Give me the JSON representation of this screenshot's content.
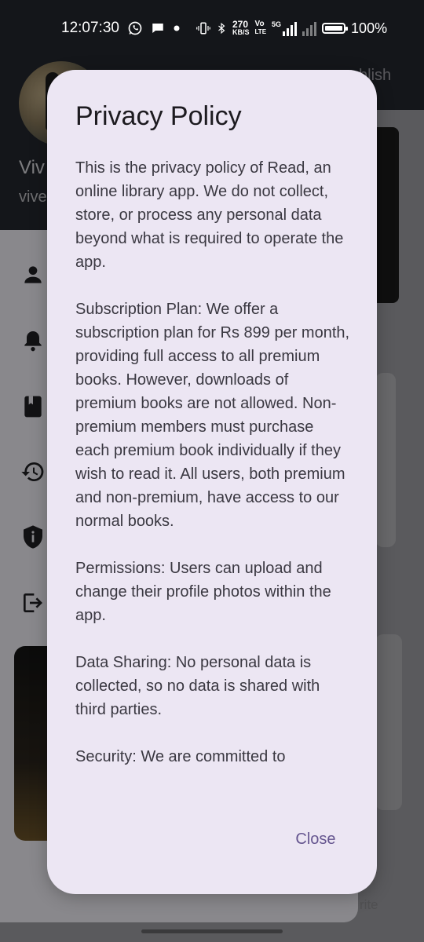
{
  "status_bar": {
    "time": "12:07:30",
    "net_speed_value": "270",
    "net_speed_unit": "KB/S",
    "volte_top": "Vo",
    "volte_bottom": "LTE",
    "signal_label": "5G",
    "battery_percent": "100%",
    "battery_level": 1.0
  },
  "background": {
    "drawer_name": "Viv",
    "drawer_email": "vive",
    "appbar_fragment": "blish",
    "bottom_fragment": "rite",
    "menu_icons": [
      "person-icon",
      "bell-icon",
      "book-icon",
      "history-icon",
      "shield-info-icon",
      "logout-icon"
    ]
  },
  "dialog": {
    "title": "Privacy Policy",
    "paragraphs": [
      "This is the privacy policy of Read, an online library app. We do not collect, store, or process any personal data beyond what is required to operate the app.",
      "Subscription Plan: We offer a subscription plan for Rs 899 per month, providing full access to all premium books. However, downloads of premium books are not allowed. Non-premium members must purchase each premium book individually if they wish to read it. All users, both premium and non-premium, have access to our normal books.",
      "Permissions: Users can upload and change their profile photos within the app.",
      "Data Sharing: No personal data is collected, so no data is shared with third parties.",
      "Security: We are committed to"
    ],
    "close_label": "Close"
  },
  "colors": {
    "dialog_bg": "#ece6f3",
    "accent": "#65558f",
    "header_bg": "#23262d"
  }
}
